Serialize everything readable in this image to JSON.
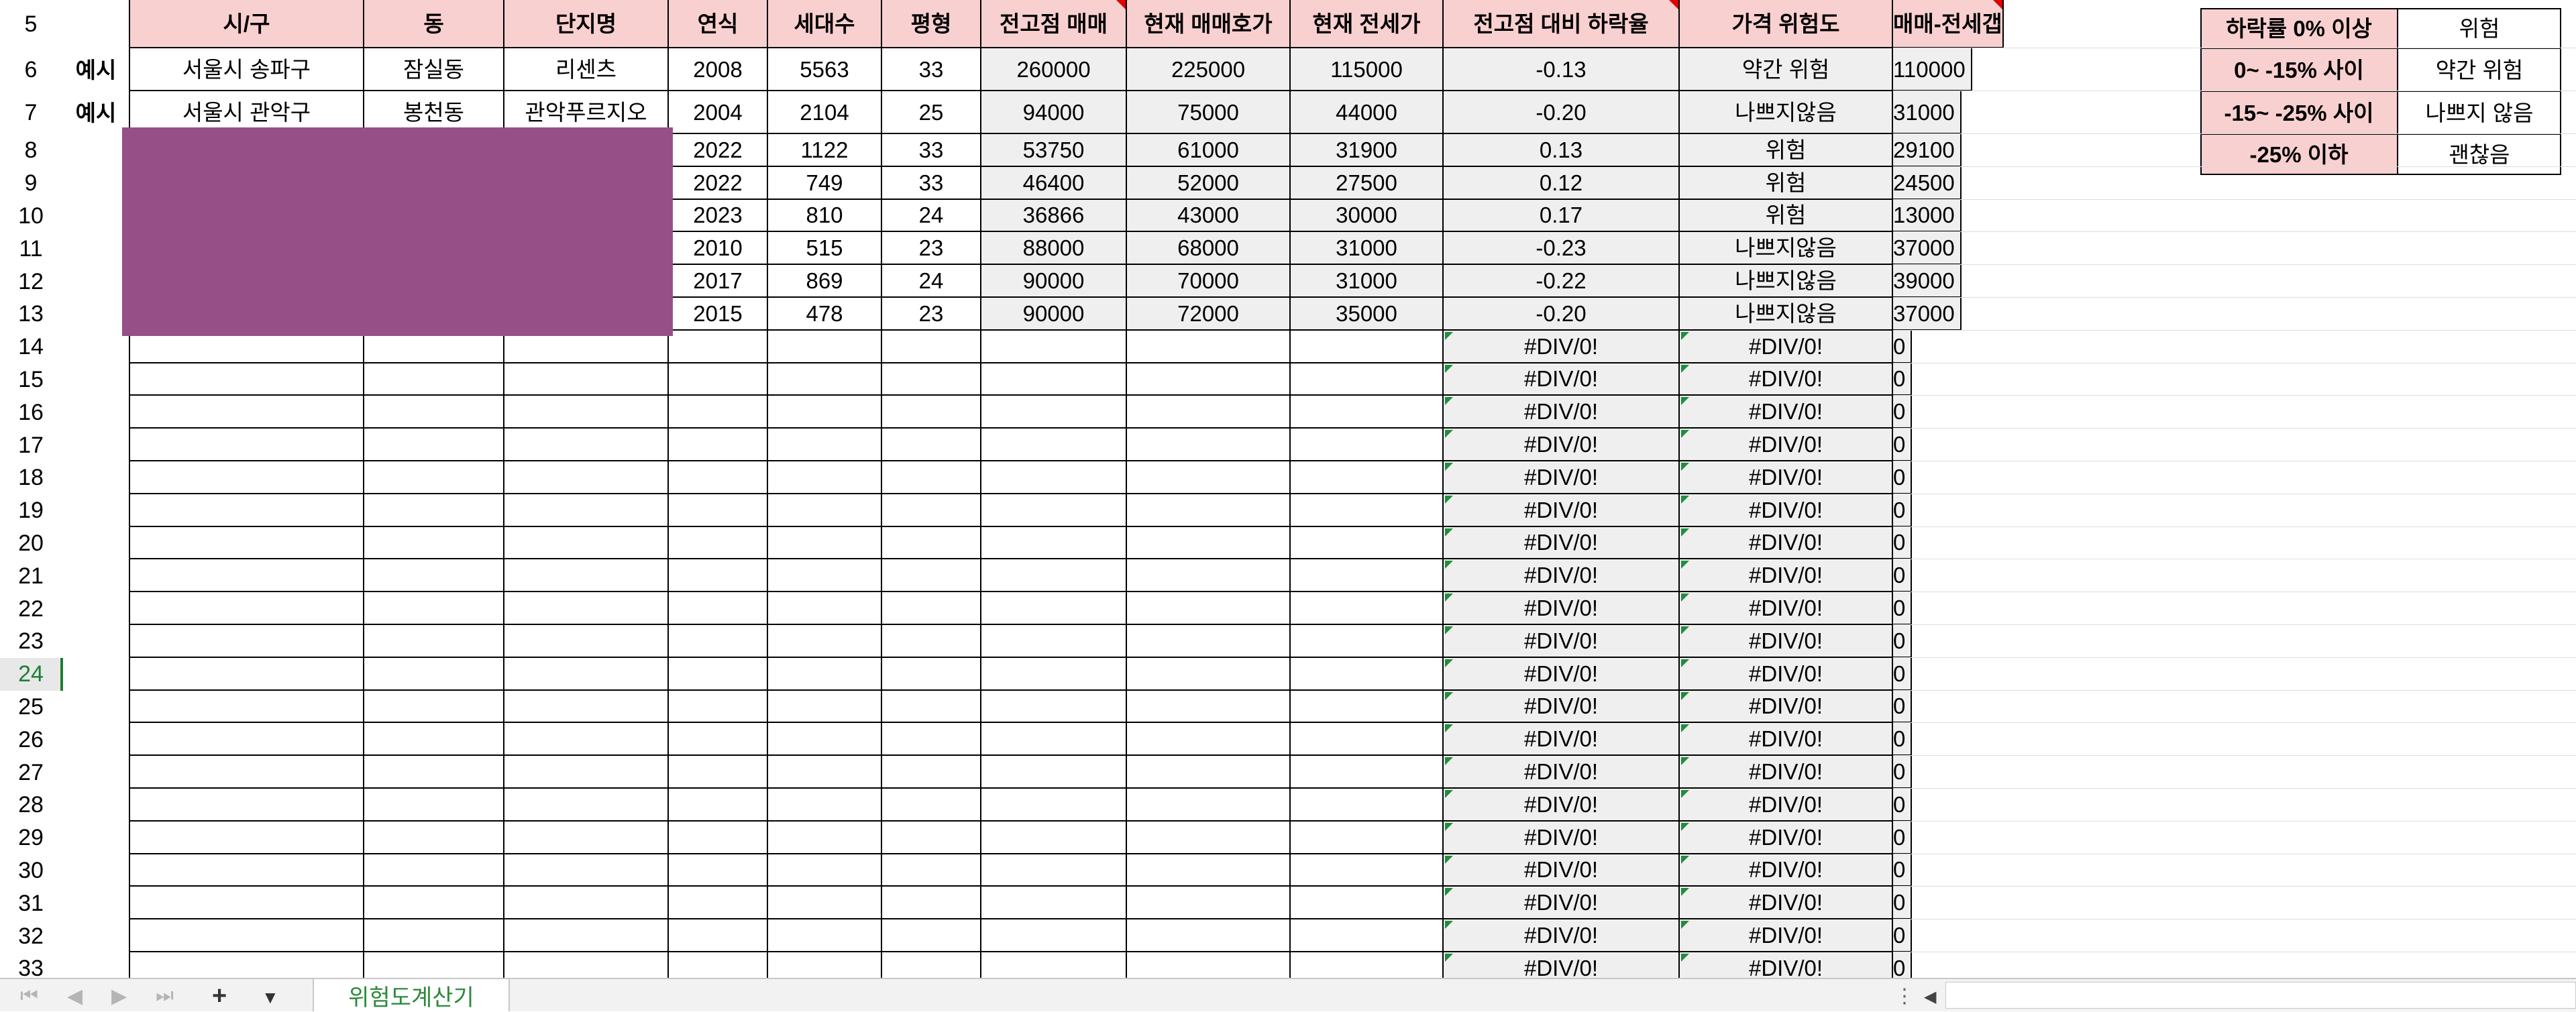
{
  "sheet": {
    "header_row": "5",
    "headers": [
      "시/구",
      "동",
      "단지명",
      "연식",
      "세대수",
      "평형",
      "전고점 매매",
      "현재 매매호가",
      "현재 전세가",
      "전고점 대비 하락율",
      "가격 위험도",
      "매매-전세갭"
    ],
    "rows": [
      {
        "row": "6",
        "label": "예시",
        "city": "서울시 송파구",
        "dong": "잠실동",
        "complex": "리센츠",
        "year": "2008",
        "households": "5563",
        "size": "33",
        "peak": "260000",
        "current": "225000",
        "jeonse": "115000",
        "drop": "-0.13",
        "risk": "약간 위험",
        "gap": "110000"
      },
      {
        "row": "7",
        "label": "예시",
        "city": "서울시 관악구",
        "dong": "봉천동",
        "complex": "관악푸르지오",
        "year": "2004",
        "households": "2104",
        "size": "25",
        "peak": "94000",
        "current": "75000",
        "jeonse": "44000",
        "drop": "-0.20",
        "risk": "나쁘지않음",
        "gap": "31000"
      },
      {
        "row": "8",
        "label": "",
        "city": "",
        "dong": "",
        "complex": "",
        "year": "2022",
        "households": "1122",
        "size": "33",
        "peak": "53750",
        "current": "61000",
        "jeonse": "31900",
        "drop": "0.13",
        "risk": "위험",
        "gap": "29100"
      },
      {
        "row": "9",
        "label": "",
        "city": "",
        "dong": "",
        "complex": "",
        "year": "2022",
        "households": "749",
        "size": "33",
        "peak": "46400",
        "current": "52000",
        "jeonse": "27500",
        "drop": "0.12",
        "risk": "위험",
        "gap": "24500"
      },
      {
        "row": "10",
        "label": "",
        "city": "",
        "dong": "",
        "complex": "",
        "year": "2023",
        "households": "810",
        "size": "24",
        "peak": "36866",
        "current": "43000",
        "jeonse": "30000",
        "drop": "0.17",
        "risk": "위험",
        "gap": "13000"
      },
      {
        "row": "11",
        "label": "",
        "city": "",
        "dong": "",
        "complex": "",
        "year": "2010",
        "households": "515",
        "size": "23",
        "peak": "88000",
        "current": "68000",
        "jeonse": "31000",
        "drop": "-0.23",
        "risk": "나쁘지않음",
        "gap": "37000"
      },
      {
        "row": "12",
        "label": "",
        "city": "",
        "dong": "",
        "complex": "",
        "year": "2017",
        "households": "869",
        "size": "24",
        "peak": "90000",
        "current": "70000",
        "jeonse": "31000",
        "drop": "-0.22",
        "risk": "나쁘지않음",
        "gap": "39000"
      },
      {
        "row": "13",
        "label": "",
        "city": "",
        "dong": "",
        "complex": "",
        "year": "2015",
        "households": "478",
        "size": "23",
        "peak": "90000",
        "current": "72000",
        "jeonse": "35000",
        "drop": "-0.20",
        "risk": "나쁘지않음",
        "gap": "37000"
      }
    ],
    "empty_rows": [
      "14",
      "15",
      "16",
      "17",
      "18",
      "19",
      "20",
      "21",
      "22",
      "23",
      "24",
      "25",
      "26",
      "27",
      "28",
      "29",
      "30",
      "31",
      "32",
      "33"
    ],
    "selected_row": "24",
    "error_value": "#DIV/0!",
    "zero_value": "0",
    "legend": [
      {
        "range": "하락률 0% 이상",
        "risk": "위험"
      },
      {
        "range": "0~ -15% 사이",
        "risk": "약간 위험"
      },
      {
        "range": "-15~ -25% 사이",
        "risk": "나쁘지 않음"
      },
      {
        "range": "-25% 이하",
        "risk": "괜찮음"
      }
    ],
    "colors": {
      "header_fill": "#f9d0d0",
      "calc_fill": "#efefef",
      "redaction": "#974f87",
      "active_tab_text": "#2c8a3a"
    }
  },
  "tabs": {
    "nav_first": "⏮",
    "nav_prev": "◀",
    "nav_next": "▶",
    "nav_last": "⏭",
    "add_label": "+",
    "menu_label": "▼",
    "active": "위험도계산기",
    "scroll_left": "◀",
    "scroll_grip": "⋮"
  }
}
